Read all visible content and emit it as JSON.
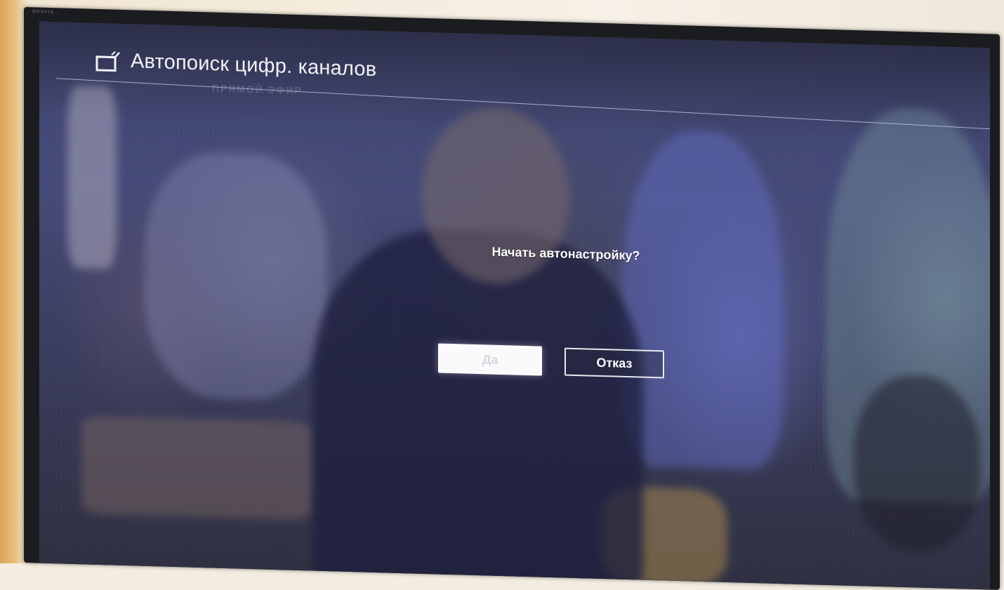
{
  "tv": {
    "brand_mark": "BRAVIA"
  },
  "header": {
    "title": "Автопоиск цифр. каналов",
    "icon": "tv-antenna-icon"
  },
  "background_broadcast": {
    "ghost_text": "ПРЯМОЙ ЭФИР"
  },
  "dialog": {
    "question": "Начать автонастройку?",
    "ok_label": "Да",
    "cancel_label": "Отказ"
  },
  "colors": {
    "text": "#ffffff",
    "focused_button_bg": "#fafafc",
    "button_border": "#e8e8ee"
  }
}
